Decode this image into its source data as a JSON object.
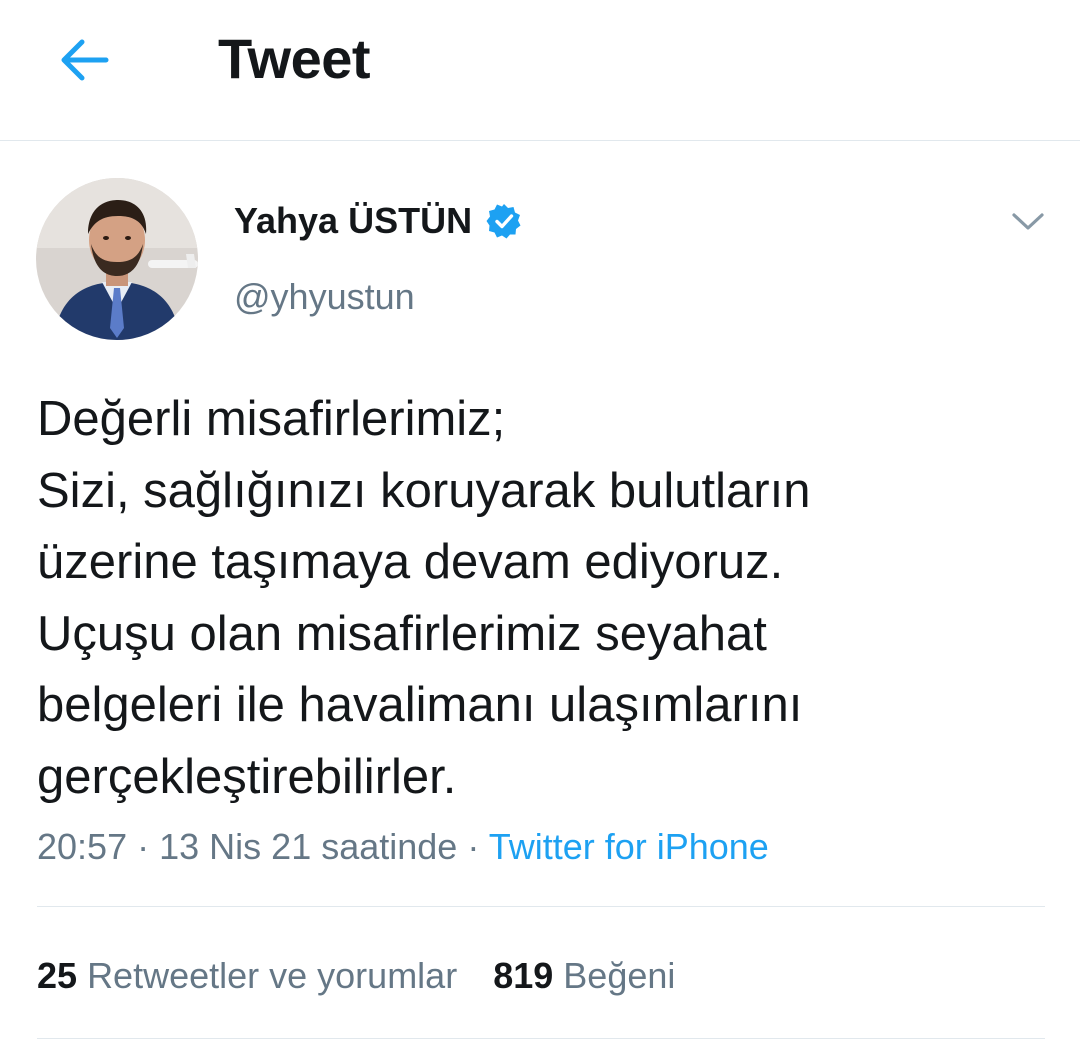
{
  "header": {
    "back_icon": "arrow-left-icon",
    "title": "Tweet"
  },
  "author": {
    "name": "Yahya ÜSTÜN",
    "handle": "@yhyustun",
    "verified_icon": "verified-badge-icon",
    "menu_icon": "chevron-down-icon"
  },
  "tweet": {
    "lines": [
      "Değerli misafirlerimiz;",
      "Sizi, sağlığınızı koruyarak bulutların",
      "üzerine taşımaya devam ediyoruz.",
      "Uçuşu olan misafirlerimiz seyahat",
      "belgeleri ile havalimanı ulaşımlarını",
      "gerçekleştirebilirler."
    ],
    "time": "20:57",
    "separator": "·",
    "date": "13 Nis 21 saatinde",
    "source": "Twitter for iPhone"
  },
  "stats": {
    "retweets_count": "25",
    "retweets_label": "Retweetler ve yorumlar",
    "likes_count": "819",
    "likes_label": "Beğeni"
  },
  "colors": {
    "accent": "#1da1f2",
    "secondary_text": "#657786",
    "divider": "#e1e8ed"
  }
}
